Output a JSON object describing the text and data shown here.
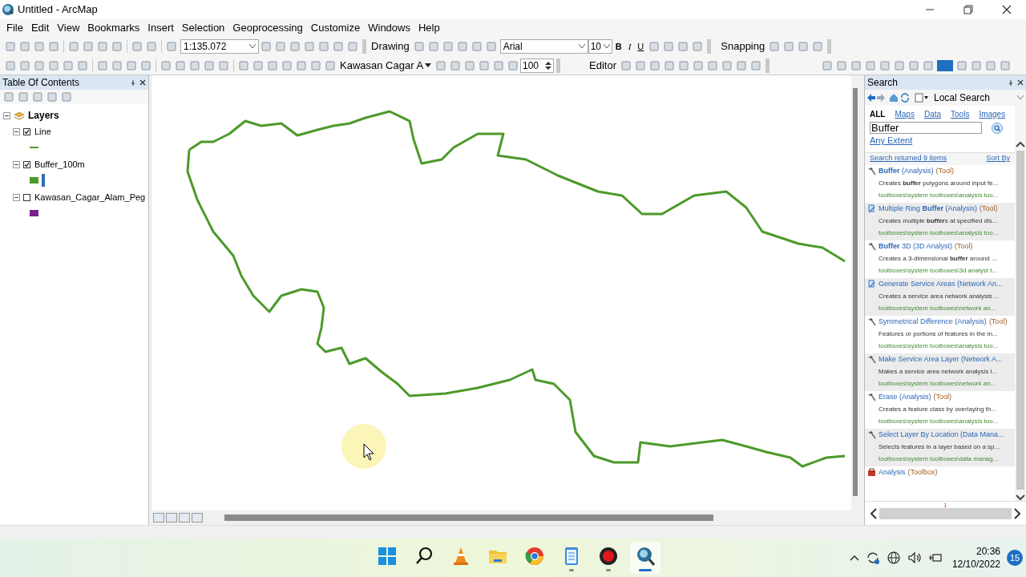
{
  "window": {
    "title": "Untitled - ArcMap"
  },
  "menu": [
    "File",
    "Edit",
    "View",
    "Bookmarks",
    "Insert",
    "Selection",
    "Geoprocessing",
    "Customize",
    "Windows",
    "Help"
  ],
  "toolbar": {
    "scale": "1:135.072",
    "drawing": "Drawing",
    "font": "Arial",
    "font_size": "10",
    "bold": "B",
    "italic": "I",
    "underline": "U",
    "snapping": "Snapping",
    "layer": "Kawasan Cagar A",
    "transparency": "100",
    "editor": "Editor"
  },
  "toc": {
    "title": "Table Of Contents",
    "root": {
      "label": "Layers",
      "expanded": true,
      "children": [
        {
          "label": "Line",
          "checked": true,
          "expanded": true,
          "kind": "line",
          "color": "#4c9a2a"
        },
        {
          "label": "Buffer_100m",
          "checked": true,
          "expanded": true,
          "kind": "fill",
          "color": "#4c9a2a"
        },
        {
          "label": "Kawasan_Cagar_Alam_Peg",
          "checked": false,
          "expanded": true,
          "kind": "fill",
          "color": "#7a1f8c"
        }
      ]
    }
  },
  "search": {
    "title": "Search",
    "location": "Local Search",
    "filters": [
      {
        "label": "ALL",
        "selected": true
      },
      {
        "label": "Maps",
        "selected": false
      },
      {
        "label": "Data",
        "selected": false
      },
      {
        "label": "Tools",
        "selected": false
      },
      {
        "label": "Images",
        "selected": false
      }
    ],
    "query": "Buffer",
    "extent": "Any Extent",
    "summary": "Search returned 9 items",
    "sort": "Sort By",
    "results": [
      {
        "kind": "tool",
        "title": "**Buffer** (Analysis)",
        "tag": "(Tool)",
        "description": "Creates **buffer** polygons around input fe...",
        "path": "toolboxes\\system toolboxes\\analysis too...",
        "highlighted": false
      },
      {
        "kind": "script",
        "title": "Multiple Ring **Buffer** (Analysis)",
        "tag": "(Tool)",
        "description": "Creates multiple **buffer**s at specified dis...",
        "path": "toolboxes\\system toolboxes\\analysis too...",
        "highlighted": true
      },
      {
        "kind": "tool",
        "title": "**Buffer** 3D (3D Analyst)",
        "tag": "(Tool)",
        "description": "Creates a 3-dimensional **buffer** around ...",
        "path": "toolboxes\\system toolboxes\\3d analyst t...",
        "highlighted": false
      },
      {
        "kind": "script",
        "title": "Generate Service Areas (Network An...",
        "description": "Creates a service area network analysis ...",
        "path": "toolboxes\\system toolboxes\\network an...",
        "highlighted": true
      },
      {
        "kind": "tool",
        "title": "Symmetrical Difference (Analysis)",
        "tag": "(Tool)",
        "description": "Features or portions of features in the in...",
        "path": "toolboxes\\system toolboxes\\analysis too...",
        "highlighted": false
      },
      {
        "kind": "tool",
        "title": "Make Service Area Layer (Network A...",
        "description": "Makes a service area network analysis l...",
        "path": "toolboxes\\system toolboxes\\network an...",
        "highlighted": true
      },
      {
        "kind": "tool",
        "title": "Erase (Analysis)",
        "tag": "(Tool)",
        "description": "Creates a feature class by overlaying th...",
        "path": "toolboxes\\system toolboxes\\analysis too...",
        "highlighted": false
      },
      {
        "kind": "tool",
        "title": "Select Layer By Location (Data Mana...",
        "description": "Selects features in a layer based on a sp...",
        "path": "toolboxes\\system toolboxes\\data manag...",
        "highlighted": true
      },
      {
        "kind": "toolbox",
        "title": "Analysis",
        "tag": "(Toolbox)",
        "highlighted": false
      }
    ],
    "page": "1"
  },
  "taskbar": {
    "apps": [
      {
        "kind": "start",
        "running": false,
        "active": false
      },
      {
        "kind": "search",
        "running": false,
        "active": false
      },
      {
        "kind": "cone",
        "running": false,
        "active": false
      },
      {
        "kind": "folder",
        "running": false,
        "active": false
      },
      {
        "kind": "browser",
        "running": false,
        "active": false
      },
      {
        "kind": "notepad",
        "running": true,
        "active": false
      },
      {
        "kind": "record",
        "running": true,
        "active": false
      },
      {
        "kind": "globe",
        "running": true,
        "active": true
      }
    ],
    "time": "20:36",
    "date": "12/10/2022",
    "notifications": "15"
  }
}
